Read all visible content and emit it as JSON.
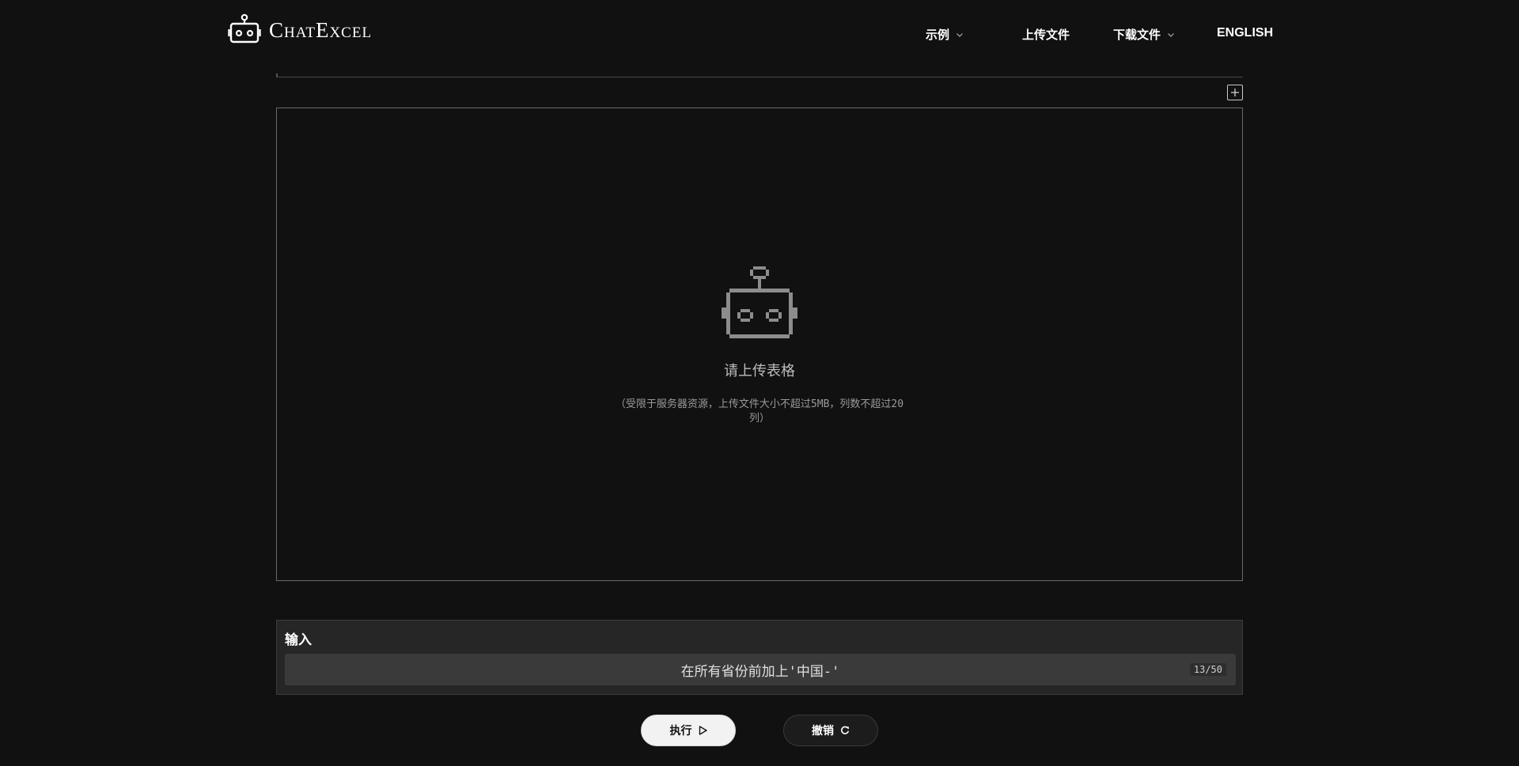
{
  "brand": {
    "name": "ChatExcel"
  },
  "nav": {
    "examples": "示例",
    "upload": "上传文件",
    "download": "下载文件",
    "language": "ENGLISH"
  },
  "table": {
    "empty_title": "请上传表格",
    "empty_hint": "（受限于服务器资源，上传文件大小不超过5MB，列数不超过20列）"
  },
  "input": {
    "label": "输入",
    "value": "在所有省份前加上'中国-'",
    "counter": "13/50"
  },
  "actions": {
    "run_label": "执行",
    "undo_label": "撤销"
  },
  "icons": {
    "logo": "robot-icon",
    "empty": "robot-icon",
    "expand": "plus-square-icon",
    "run": "play-icon",
    "undo": "refresh-icon",
    "dropdown": "chevron-down-icon"
  },
  "colors": {
    "background": "#111111",
    "panel": "#262626",
    "input_bg": "#3a3a3a",
    "accent_light": "#f2f2f2"
  }
}
